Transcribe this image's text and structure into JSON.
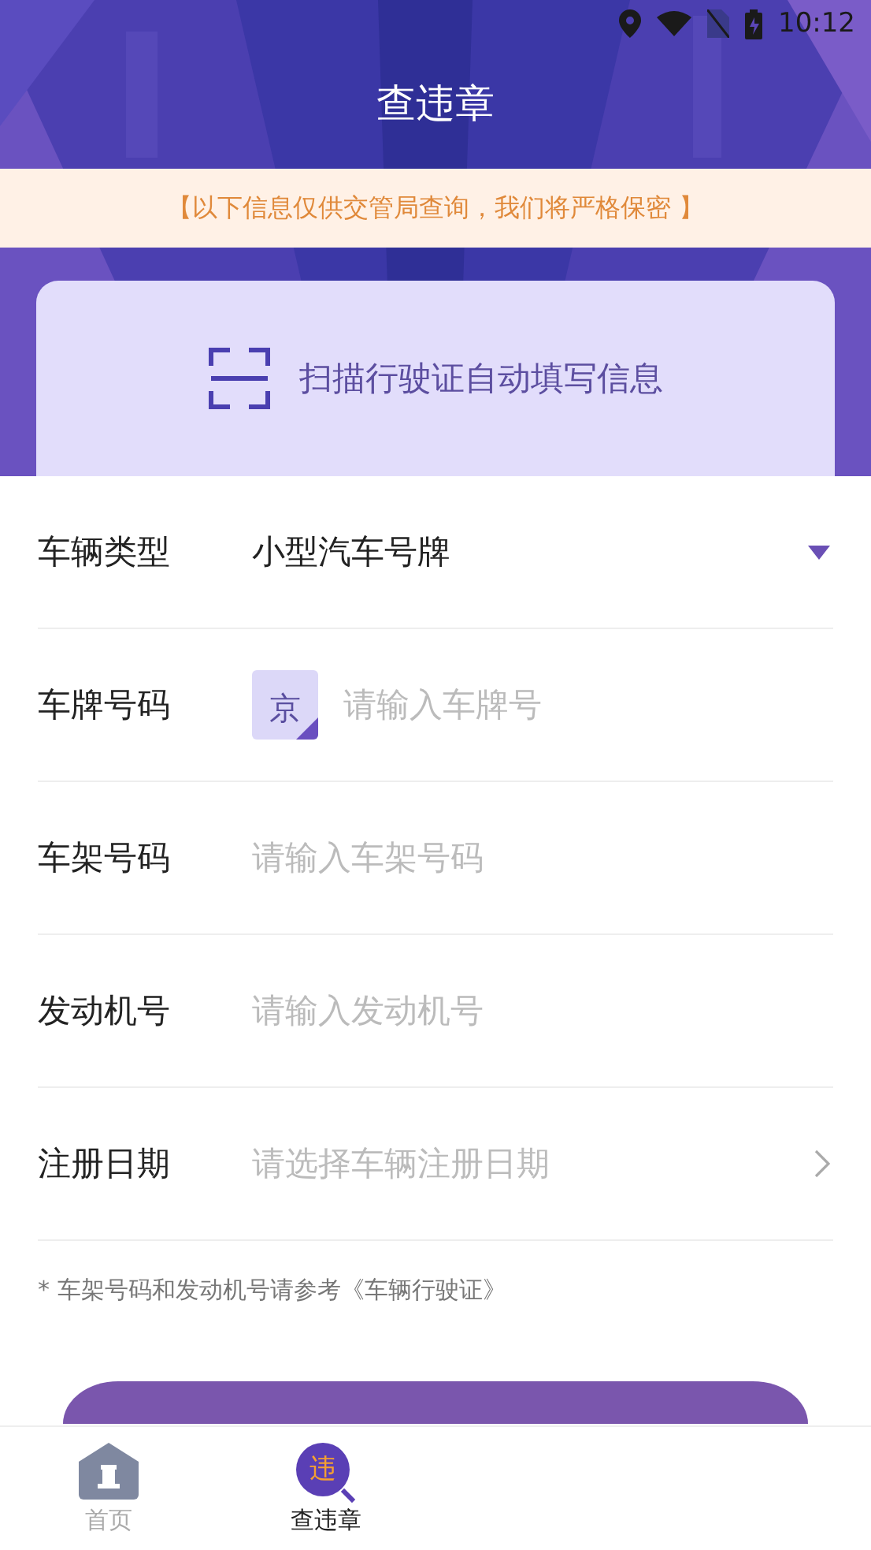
{
  "status_bar": {
    "time": "10:12"
  },
  "header": {
    "title": "查违章"
  },
  "notice": "【以下信息仅供交管局查询，我们将严格保密 】",
  "scan_card": {
    "label": "扫描行驶证自动填写信息"
  },
  "form": [
    {
      "kind": "select",
      "label": "车辆类型",
      "value": "小型汽车号牌"
    },
    {
      "kind": "plate",
      "label": "车牌号码",
      "prefix": "京",
      "placeholder": "请输入车牌号"
    },
    {
      "kind": "input",
      "label": "车架号码",
      "placeholder": "请输入车架号码"
    },
    {
      "kind": "input",
      "label": "发动机号",
      "placeholder": "请输入发动机号"
    },
    {
      "kind": "date",
      "label": "注册日期",
      "placeholder": "请选择车辆注册日期"
    }
  ],
  "note": "* 车架号码和发动机号请参考《车辆行驶证》",
  "tabs": [
    {
      "kind": "home",
      "label": "首页",
      "selected": false
    },
    {
      "kind": "violation",
      "label": "查违章",
      "icon_text": "违",
      "selected": true
    }
  ]
}
